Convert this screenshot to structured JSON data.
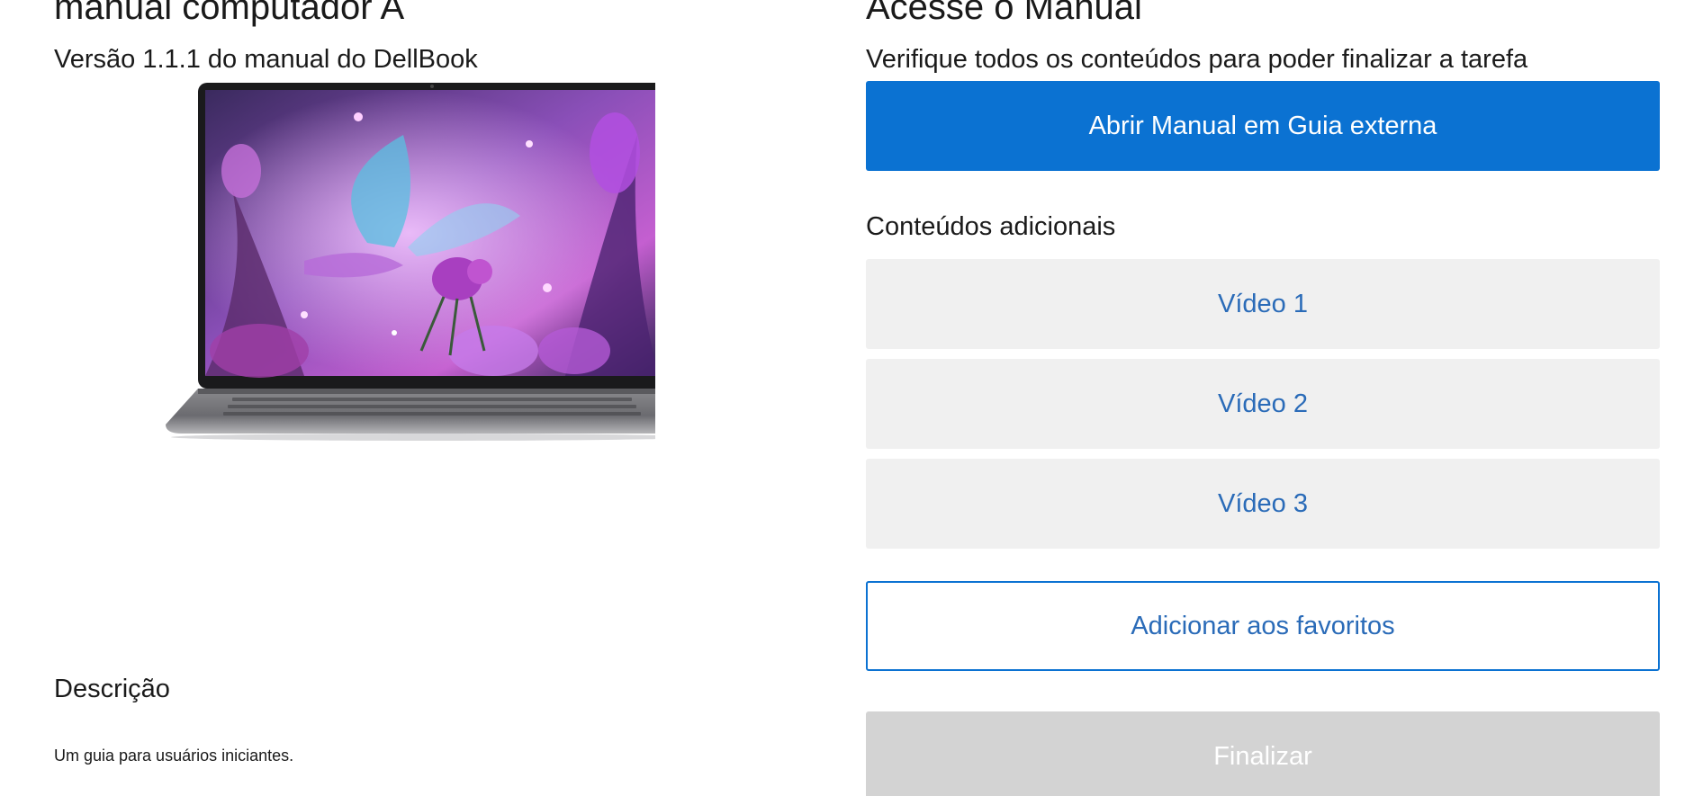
{
  "product": {
    "title": "manual computador A",
    "version": "Versão 1.1.1 do manual do DellBook",
    "description_label": "Descrição",
    "description_text": "Um guia para usuários iniciantes."
  },
  "access": {
    "title": "Acesse o Manual",
    "subtitle": "Verifique todos os conteúdos para poder finalizar a tarefa",
    "open_button": "Abrir Manual em Guia externa"
  },
  "additional": {
    "label": "Conteúdos adicionais",
    "videos": [
      "Vídeo 1",
      "Vídeo 2",
      "Vídeo 3"
    ]
  },
  "actions": {
    "favorite_button": "Adicionar aos favoritos",
    "finish_button": "Finalizar"
  },
  "colors": {
    "primary": "#0b72d2",
    "link_text": "#2a6bb8",
    "video_bg": "#f0f0f0",
    "disabled_bg": "#d3d3d3"
  },
  "images": {
    "product_image": "laptop-image"
  }
}
